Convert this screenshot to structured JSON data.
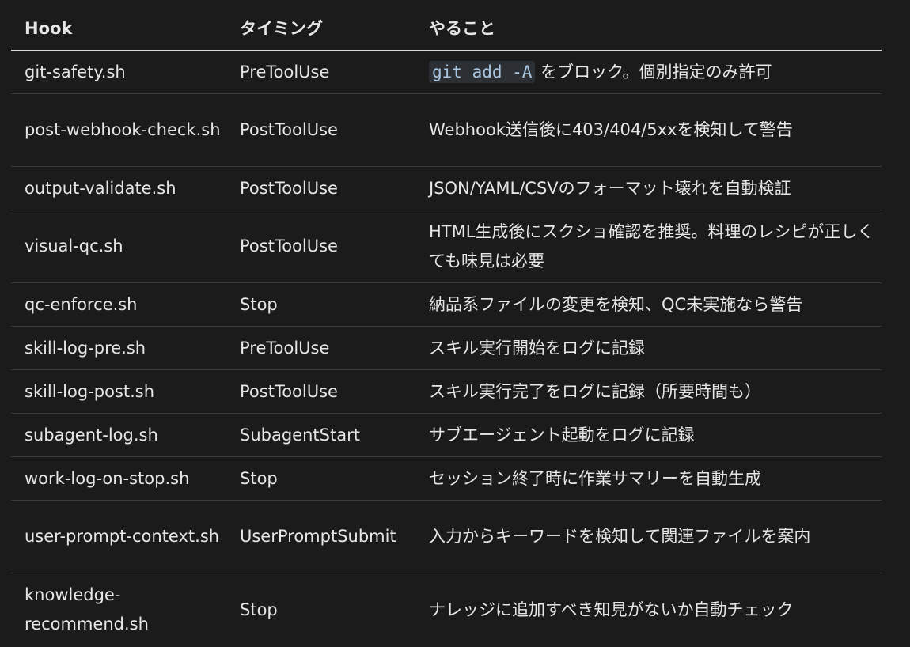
{
  "columns": {
    "hook": "Hook",
    "timing": "タイミング",
    "action": "やること"
  },
  "rows": [
    {
      "hook": "git-safety.sh",
      "timing": "PreToolUse",
      "code": "git add -A",
      "action": "をブロック。個別指定のみ許可"
    },
    {
      "hook": "post-webhook-check.sh",
      "timing": "PostToolUse",
      "action": "Webhook送信後に403/404/5xxを検知して警告"
    },
    {
      "hook": "output-validate.sh",
      "timing": "PostToolUse",
      "action": "JSON/YAML/CSVのフォーマット壊れを自動検証"
    },
    {
      "hook": "visual-qc.sh",
      "timing": "PostToolUse",
      "action": "HTML生成後にスクショ確認を推奨。料理のレシピが正しくても味見は必要"
    },
    {
      "hook": "qc-enforce.sh",
      "timing": "Stop",
      "action": "納品系ファイルの変更を検知、QC未実施なら警告"
    },
    {
      "hook": "skill-log-pre.sh",
      "timing": "PreToolUse",
      "action": "スキル実行開始をログに記録"
    },
    {
      "hook": "skill-log-post.sh",
      "timing": "PostToolUse",
      "action": "スキル実行完了をログに記録（所要時間も）"
    },
    {
      "hook": "subagent-log.sh",
      "timing": "SubagentStart",
      "action": "サブエージェント起動をログに記録"
    },
    {
      "hook": "work-log-on-stop.sh",
      "timing": "Stop",
      "action": "セッション終了時に作業サマリーを自動生成"
    },
    {
      "hook": "user-prompt-context.sh",
      "timing": "UserPromptSubmit",
      "action": "入力からキーワードを検知して関連ファイルを案内"
    },
    {
      "hook": "knowledge-recommend.sh",
      "timing": "Stop",
      "action": "ナレッジに追加すべき知見がないか自動チェック"
    }
  ]
}
